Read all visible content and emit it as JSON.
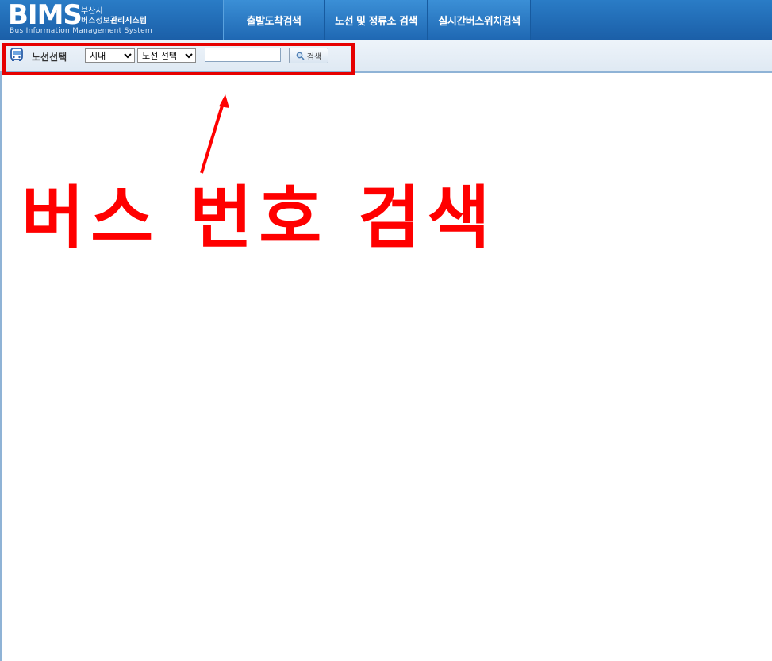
{
  "header": {
    "logo_mark": "BIMS",
    "logo_city": "부산시",
    "logo_name_prefix": "버스정보",
    "logo_name_suffix": "관리시스템",
    "logo_sub": "Bus Information Management System",
    "tabs": [
      {
        "label": "출발도착검색"
      },
      {
        "label": "노선 및 정류소 검색"
      },
      {
        "label": "실시간버스위치검색"
      }
    ]
  },
  "toolbar": {
    "icon": "bus-icon",
    "label": "노선선택",
    "region_select": {
      "value": "시내"
    },
    "route_select": {
      "value": "노선 선택"
    },
    "search_input": {
      "value": ""
    },
    "search_button": {
      "label": "검색",
      "icon": "magnifier-icon"
    }
  },
  "annotation": {
    "text": "버스 번호 검색",
    "color": "#ff0000"
  },
  "colors": {
    "header": "#1f6bb5",
    "annotation": "#ff0000"
  }
}
